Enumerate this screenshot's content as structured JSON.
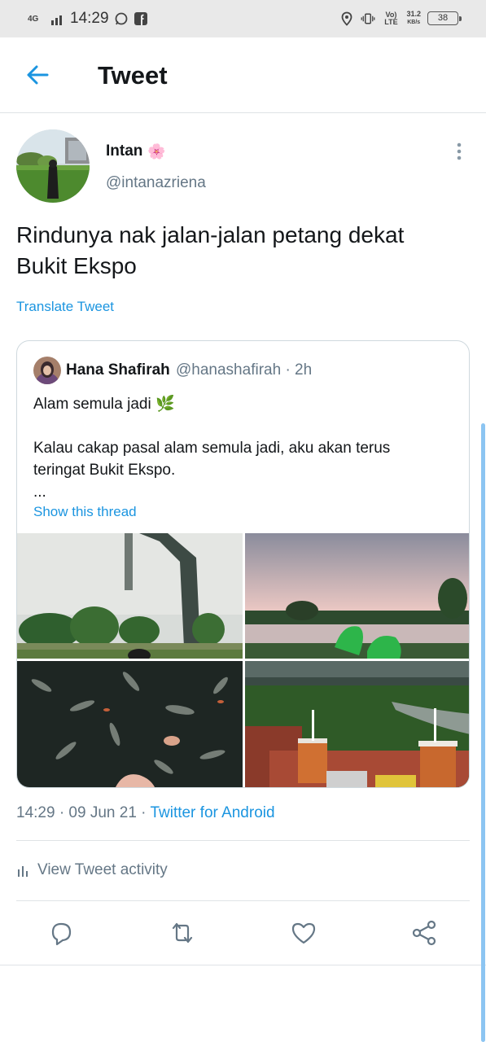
{
  "status_bar": {
    "network": "4G",
    "time": "14:29",
    "volte": "Vo) LTE",
    "speed": "31.2",
    "speed_unit": "KB/s",
    "battery": "38"
  },
  "header": {
    "title": "Tweet",
    "back_icon": "arrow-left-icon"
  },
  "tweet": {
    "author_name": "Intan",
    "author_emoji": "🌸",
    "author_handle": "@intanazriena",
    "text": "Rindunya nak jalan-jalan petang dekat Bukit Ekspo",
    "translate_label": "Translate Tweet",
    "timestamp": "14:29 · 09 Jun 21 · ",
    "source": "Twitter for Android",
    "activity_label": "View Tweet activity"
  },
  "quote": {
    "name": "Hana Shafirah",
    "handle": "@hanashafirah",
    "time": "· 2h",
    "line1": "Alam semula jadi 🌿",
    "line2": "",
    "line3": "Kalau cakap pasal alam semula jadi, aku akan terus teringat Bukit Ekspo.",
    "line4": "...",
    "show_thread": "Show this thread"
  },
  "colors": {
    "accent": "#1b95e0",
    "muted": "#657786",
    "text": "#14171a",
    "divider": "#dfe3e6"
  }
}
